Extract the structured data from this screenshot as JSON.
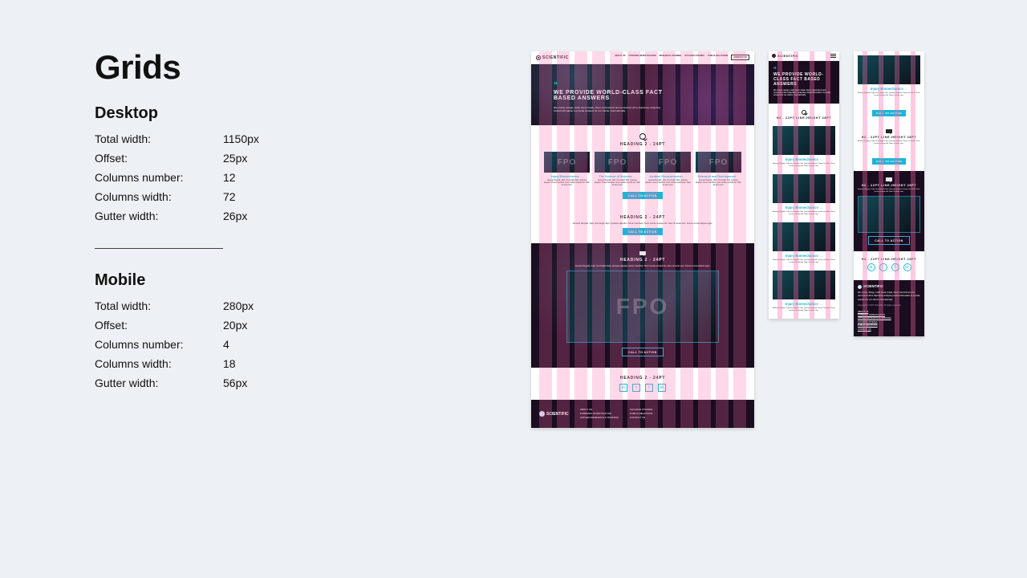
{
  "panel": {
    "title": "Grids",
    "desktop": {
      "heading": "Desktop",
      "rows": [
        {
          "k": "Total width:",
          "v": "1150px"
        },
        {
          "k": "Offset:",
          "v": "25px"
        },
        {
          "k": "Columns number:",
          "v": "12"
        },
        {
          "k": "Columns width:",
          "v": "72"
        },
        {
          "k": "Gutter width:",
          "v": "26px"
        }
      ]
    },
    "mobile": {
      "heading": "Mobile",
      "rows": [
        {
          "k": "Total width:",
          "v": "280px"
        },
        {
          "k": "Offset:",
          "v": "20px"
        },
        {
          "k": "Columns number:",
          "v": "4"
        },
        {
          "k": "Columns width:",
          "v": "18"
        },
        {
          "k": "Gutter width:",
          "v": "56px"
        }
      ]
    }
  },
  "brand": "SCIENTIFIC",
  "nav": [
    "ABOUT US",
    "FORENSIC INVESTIGATION",
    "RESEARCH TRAINING",
    "SUCCESS STORIES",
    "PUBLIC RELATIONS",
    "CONTACT US"
  ],
  "hero": {
    "title": "WE PROVIDE WORLD-CLASS FACT BASED ANSWERS",
    "body": "We review, design, build, bend, break, shoot, deconstruct and reconstruct all to objectively analyzing critical information to provide answers for our clients, internationally."
  },
  "heading_label": "HEADING 2 - 24PT",
  "heading_label_m": "H2 - 22PT LINE-HEIGHT 28PT",
  "lorem_short": "Aenean Regular, 14pt, line-height 21pt. Quisque aliquam. Donec faucibus. Nunc iaculis suscipit dui. Nam sit amet sem.",
  "lorem_long": "Aenean Regular, 14pt, line-height 21pt. Quisque aliquam. Donec faucibus. Nunc iaculis suscipit dui. Nam sit amet sem. Donec et erat aliquet eges.",
  "cta": "CALL TO ACTION",
  "fpo": "FPO",
  "cards": [
    {
      "title": "Injury Biomechanics →"
    },
    {
      "title": "The Science of Violence →"
    },
    {
      "title": "Incident Reconstruction →"
    },
    {
      "title": "Research and Development →"
    }
  ],
  "tile_title": "Injury Biomechanics →",
  "socials": [
    "in",
    "t",
    "f",
    "✉"
  ],
  "footer": {
    "cols": [
      [
        "ABOUT US",
        "FORENSIC INVESTIGATION",
        "APPLIED RESEARCH & TRAINING"
      ],
      [
        "SUCCESS STORIES",
        "PUBLIC RELATIONS",
        "CONTACT US"
      ]
    ],
    "mobile_links": [
      "ABOUT US",
      "FORENSIC INVESTIGATION",
      "APPLIED RESEARCH & TRAINING",
      "SUCCESS STORIES",
      "PUBLIC RELATIONS",
      "CONTACT US"
    ],
    "blurb": "We review, design, build, bend, break, shoot, deconstruct and reconstruct all to objectively analyzing critical information to provide answers for our clients, internationally.",
    "copyright": "Copyright © 2017 Scientific. All rights reserved."
  }
}
